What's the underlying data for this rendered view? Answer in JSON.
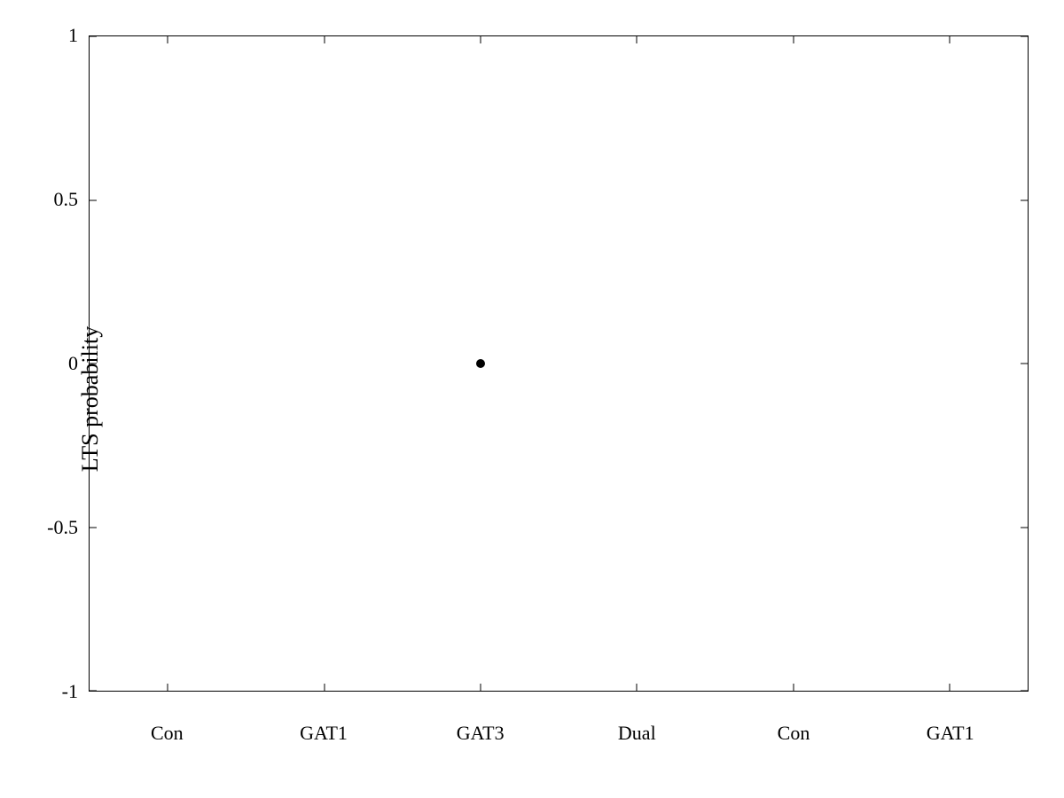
{
  "chart": {
    "title": "",
    "y_axis_label": "LTS probability",
    "y_ticks": [
      {
        "value": 1,
        "pct": 0
      },
      {
        "value": 0.5,
        "pct": 25
      },
      {
        "value": 0,
        "pct": 50
      },
      {
        "value": -0.5,
        "pct": 75
      },
      {
        "value": -1,
        "pct": 100
      }
    ],
    "x_categories": [
      "Con",
      "GAT1",
      "GAT3",
      "Dual",
      "Con",
      "GAT1"
    ],
    "x_pcts": [
      8.33,
      25,
      41.67,
      58.33,
      75,
      91.67
    ],
    "data_points": [
      {
        "x_pct": 41.67,
        "y_pct": 50,
        "label": "GAT3 at 0"
      }
    ]
  }
}
